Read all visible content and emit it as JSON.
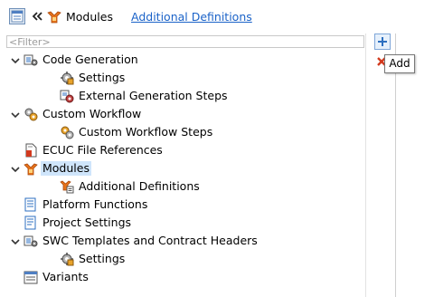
{
  "header": {
    "current": "Modules",
    "link": "Additional Definitions"
  },
  "filter": {
    "placeholder": "<Filter>"
  },
  "tree": [
    {
      "label": "Code Generation",
      "icon": "code-generation-icon",
      "depth": 0,
      "expanded": true,
      "selected": false
    },
    {
      "label": "Settings",
      "icon": "settings-icon",
      "depth": 1,
      "expanded": null,
      "selected": false
    },
    {
      "label": "External Generation Steps",
      "icon": "external-generation-icon",
      "depth": 1,
      "expanded": null,
      "selected": false
    },
    {
      "label": "Custom Workflow",
      "icon": "custom-workflow-icon",
      "depth": 0,
      "expanded": true,
      "selected": false
    },
    {
      "label": "Custom Workflow Steps",
      "icon": "workflow-steps-icon",
      "depth": 1,
      "expanded": null,
      "selected": false
    },
    {
      "label": "ECUC File References",
      "icon": "ecuc-file-icon",
      "depth": 0,
      "expanded": null,
      "selected": false
    },
    {
      "label": "Modules",
      "icon": "modules-icon",
      "depth": 0,
      "expanded": true,
      "selected": true
    },
    {
      "label": "Additional Definitions",
      "icon": "additional-definitions-icon",
      "depth": 1,
      "expanded": null,
      "selected": false
    },
    {
      "label": "Platform Functions",
      "icon": "platform-functions-icon",
      "depth": 0,
      "expanded": null,
      "selected": false
    },
    {
      "label": "Project Settings",
      "icon": "project-settings-icon",
      "depth": 0,
      "expanded": null,
      "selected": false
    },
    {
      "label": "SWC Templates and Contract Headers",
      "icon": "swc-templates-icon",
      "depth": 0,
      "expanded": true,
      "selected": false
    },
    {
      "label": "Settings",
      "icon": "settings-icon",
      "depth": 1,
      "expanded": null,
      "selected": false
    },
    {
      "label": "Variants",
      "icon": "variants-icon",
      "depth": 0,
      "expanded": null,
      "selected": false
    }
  ],
  "tooltip": {
    "text": "Add"
  },
  "colors": {
    "link": "#1a62c8",
    "selection": "#cfe5fb",
    "module_orange": "#e8731a"
  }
}
